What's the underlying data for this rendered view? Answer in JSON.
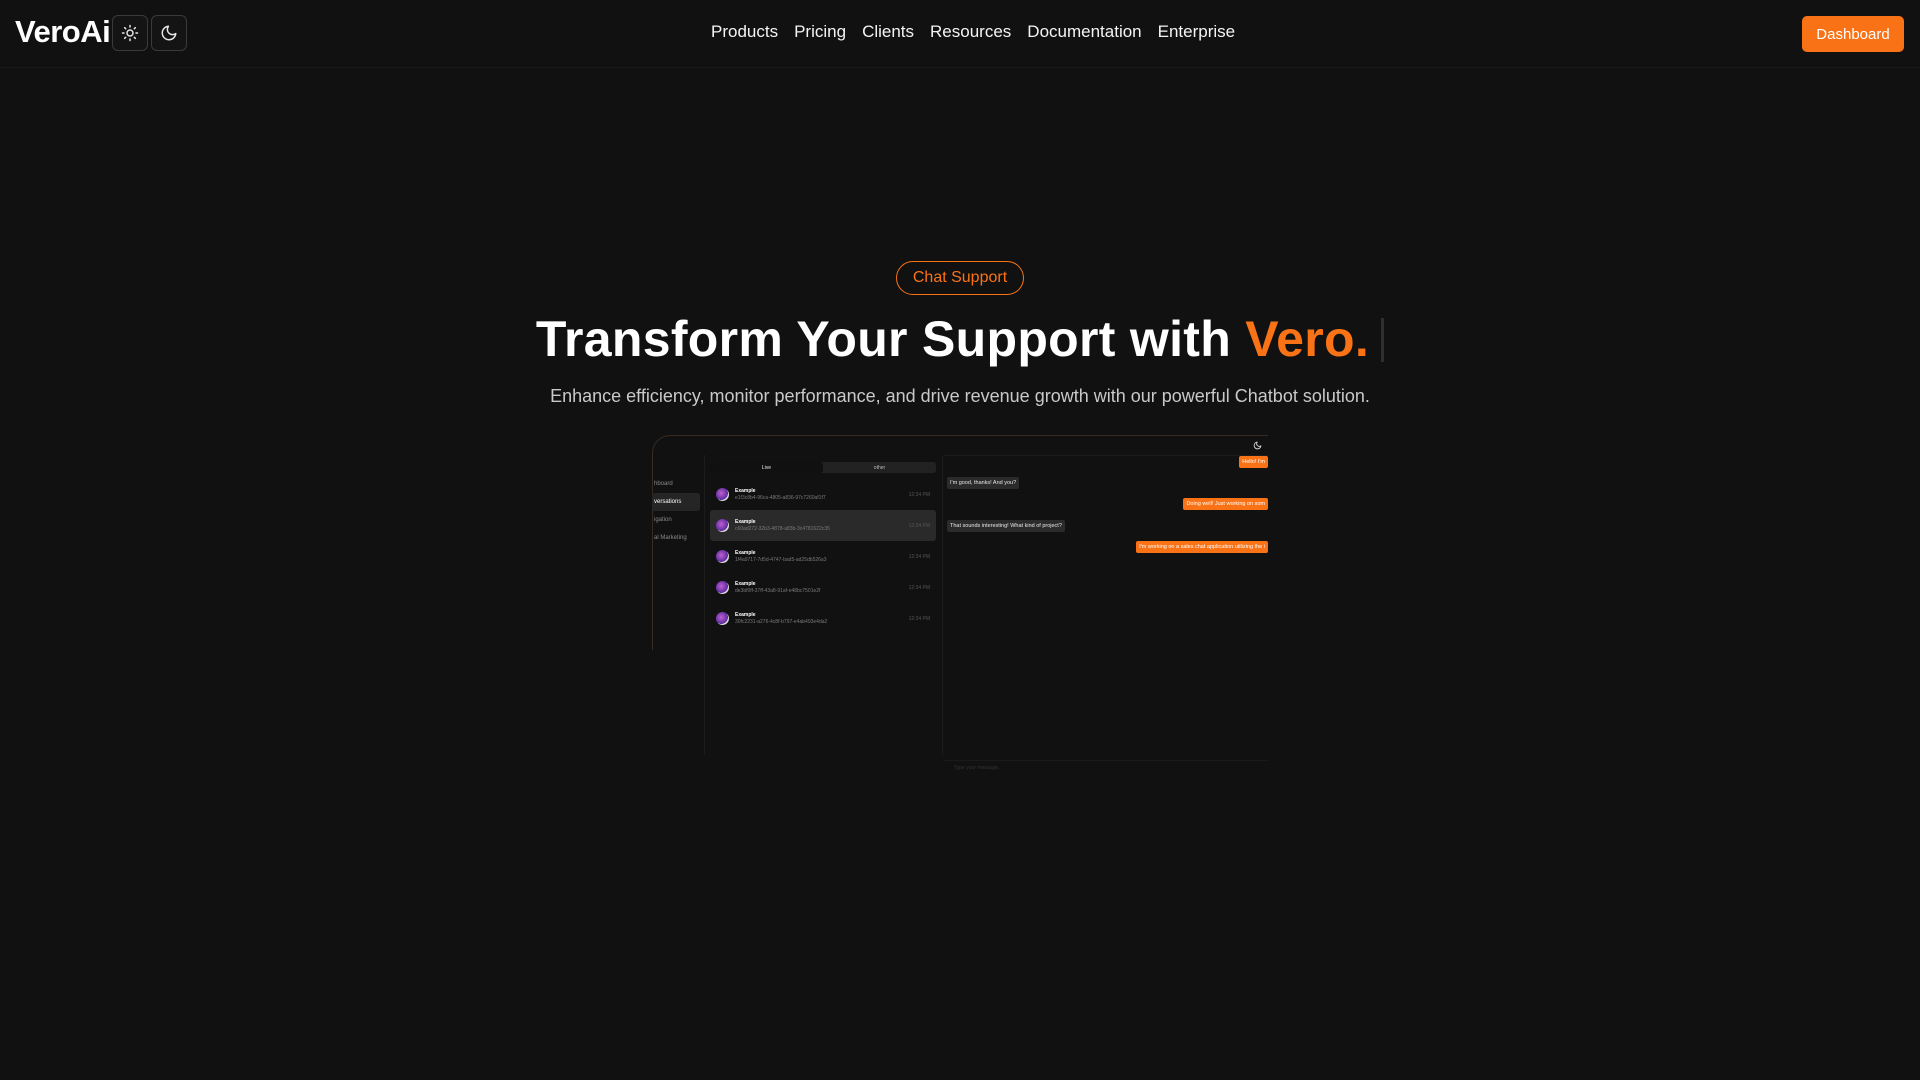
{
  "brand": {
    "name": "VeroAi",
    "accent": "#f97316"
  },
  "nav": [
    "Products",
    "Pricing",
    "Clients",
    "Resources",
    "Documentation",
    "Enterprise"
  ],
  "header": {
    "dashboard_label": "Dashboard"
  },
  "hero": {
    "badge": "Chat Support",
    "headline_main": "Transform Your Support with ",
    "headline_accent": "Vero.",
    "subheadline": "Enhance efficiency, monitor performance, and drive revenue growth with our powerful Chatbot solution."
  },
  "preview": {
    "sidebar": [
      "hboard",
      "versations",
      "igation",
      "al Marketing"
    ],
    "tabs": [
      "Live",
      "other"
    ],
    "conversations": [
      {
        "name": "Example",
        "id": "e1f3c8b4-96ca-4805-a836-97c7260af1f7",
        "time": "12:34 PM"
      },
      {
        "name": "Example",
        "id": "c60ad272-32b3-4878-a83b-3c4781622c35",
        "time": "12:34 PM"
      },
      {
        "name": "Example",
        "id": "1f4a9717-7d5d-4747-bad5-ad25db526a3",
        "time": "12:34 PM"
      },
      {
        "name": "Example",
        "id": "de3bf0ff-37ff-43a8-91af-e48bc7501e2f",
        "time": "12:34 PM"
      },
      {
        "name": "Example",
        "id": "30fc2231-a276-4c8f-b797-e4ab493e4da2",
        "time": "12:34 PM"
      }
    ],
    "messages": [
      {
        "dir": "out",
        "text": "Hello! I'm"
      },
      {
        "dir": "in",
        "text": "I'm good, thanks! And you?"
      },
      {
        "dir": "out",
        "text": "Doing well! Just working on som"
      },
      {
        "dir": "in",
        "text": "That sounds interesting! What kind of project?"
      },
      {
        "dir": "out",
        "text": "I'm working on a sales chat application utilizing the i"
      }
    ],
    "input_placeholder": "Type your message..."
  }
}
